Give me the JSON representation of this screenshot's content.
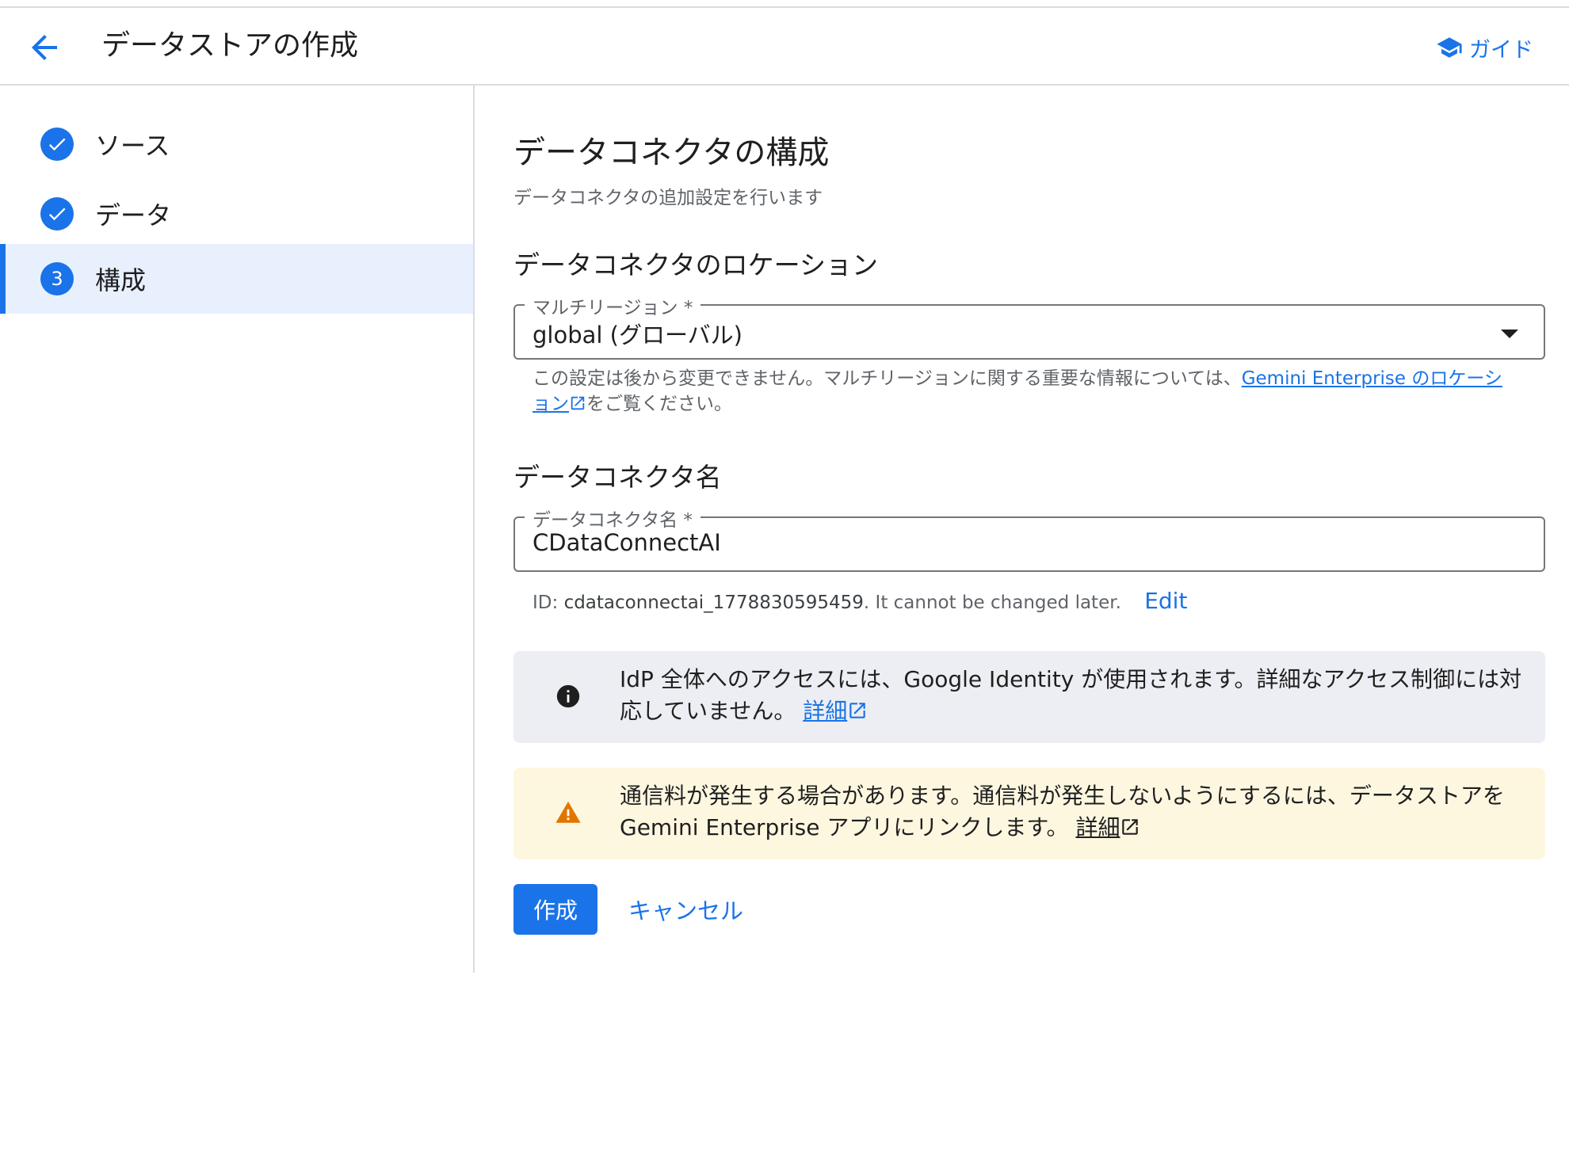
{
  "header": {
    "title": "データストアの作成",
    "guide_label": "ガイド"
  },
  "sidebar": {
    "steps": [
      {
        "label": "ソース",
        "state": "completed"
      },
      {
        "label": "データ",
        "state": "completed"
      },
      {
        "label": "構成",
        "state": "active",
        "number": "3"
      }
    ]
  },
  "main": {
    "title": "データコネクタの構成",
    "subtitle": "データコネクタの追加設定を行います",
    "location": {
      "heading": "データコネクタのロケーション",
      "field_label": "マルチリージョン *",
      "value": "global (グローバル)",
      "hint_prefix": "この設定は後から変更できません。マルチリージョンに関する重要な情報については、",
      "hint_link": "Gemini Enterprise のロケーション",
      "hint_suffix": "をご覧ください。"
    },
    "name": {
      "heading": "データコネクタ名",
      "field_label": "データコネクタ名 *",
      "value": "CDataConnectAI",
      "id_prefix": "ID: ",
      "id_value": "cdataconnectai_1778830595459",
      "id_suffix": ". It cannot be changed later.",
      "edit_label": "Edit"
    },
    "info_notice": {
      "text": "IdP 全体へのアクセスには、Google Identity が使用されます。詳細なアクセス制御には対応していません。",
      "link": "詳細"
    },
    "warning_notice": {
      "text": "通信料が発生する場合があります。通信料が発生しないようにするには、データストアを Gemini Enterprise アプリにリンクします。",
      "link": "詳細"
    },
    "actions": {
      "create_label": "作成",
      "cancel_label": "キャンセル"
    }
  },
  "colors": {
    "accent": "#1a73e8",
    "active_bg": "#e8f0fe",
    "info_bg": "#edeef3",
    "warning_bg": "#fef7e0",
    "warning_icon": "#e37400"
  },
  "icons": {
    "back": "arrow-left-icon",
    "guide": "school-cap-icon",
    "check": "check-circle-icon",
    "info": "info-icon",
    "warning": "warning-icon",
    "external": "open-in-new-icon"
  }
}
